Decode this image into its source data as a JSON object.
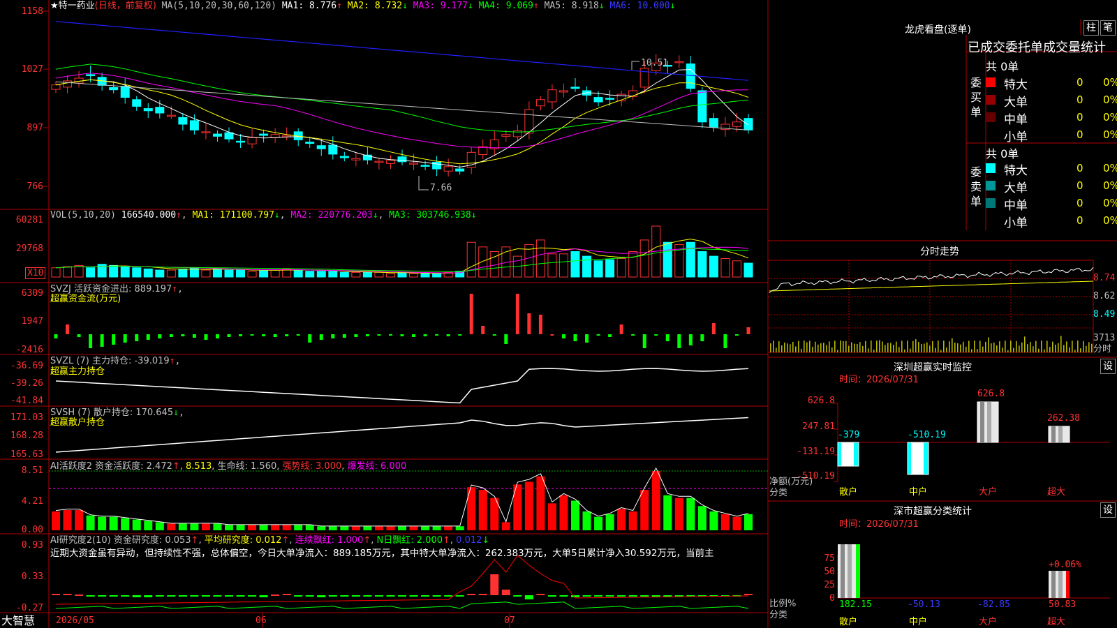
{
  "colors": {
    "up": "#ff3232",
    "down": "#00ffff",
    "grid": "#aa0000",
    "bg": "#000000",
    "ma1": "#ffffff",
    "ma2": "#ffff00",
    "ma3": "#ff00ff",
    "ma4": "#00ff00",
    "ma6": "#2020ff"
  },
  "main": {
    "title": "★特一药业",
    "mode": "(日线，前复权)",
    "ma_label": "MA(5,10,20,30,60,120)",
    "ma1": "MA1: 8.776",
    "ma2": "MA2: 8.732",
    "ma3": "MA3: 9.177",
    "ma4": "MA4: 9.069",
    "ma5": "MA5: 8.918",
    "ma6": "MA6: 10.000",
    "y_ticks": [
      "1158",
      "1027",
      "897",
      "766"
    ],
    "high_label": "10.51",
    "low_label": "7.66"
  },
  "vol": {
    "label": "VOL(5,10,20)",
    "value": "166540.000",
    "ma1": "MA1: 171100.797",
    "ma2": "MA2: 220776.203",
    "ma3": "MA3: 303746.938",
    "y_ticks": [
      "60281",
      "29768"
    ],
    "unit": "X10"
  },
  "svzj": {
    "line1": "SVZJ  活跃资金进出: 889.197",
    "line2": "超赢资金流(万元)",
    "y_ticks": [
      "6309",
      "1947",
      "-2416"
    ]
  },
  "svzl": {
    "line1": "SVZL (7) 主力持仓: -39.019",
    "line2": "超赢主力持仓",
    "y_ticks": [
      "-36.69",
      "-39.26",
      "-41.84"
    ]
  },
  "svsh": {
    "line1": "SVSH (7) 散户持仓: 170.645",
    "line2": "超赢散户持仓",
    "y_ticks": [
      "171.03",
      "168.28",
      "165.63"
    ]
  },
  "ai1": {
    "label": "AI活跃度2 资金活跃度: 2.472",
    "v2": "8.513",
    "life": "生命线: 1.560",
    "strong": "强势线: 3.000",
    "burst": "爆发线: 6.000",
    "y_ticks": [
      "8.51",
      "4.21",
      "0.00"
    ]
  },
  "ai2": {
    "label": "AI研究度2(10) 资金研究度: 0.053",
    "avg": "平均研究度: 0.012",
    "lx": "连续飘红: 1.000",
    "nr": "N日飘红: 2.000",
    "last": "0.012",
    "desc": "近期大资金虽有异动，但持续性不强，总体偏空，今日大单净流入：889.185万元，其中特大单净流入：262.383万元，大单5日累计净入30.592万元，当前主",
    "y_ticks": [
      "0.93",
      "0.33",
      "-0.27"
    ]
  },
  "xaxis": {
    "labels": [
      "2026/05",
      "06",
      "07"
    ],
    "brand": "大智慧"
  },
  "lhb": {
    "title": "龙虎看盘(逐单)",
    "btn1": "柱",
    "btn2": "笔",
    "tabs": "已成交委托单成交量统计",
    "buy_side": "委买单",
    "sell_side": "委卖单",
    "buy_total": "共 0单",
    "sell_total": "共 0单",
    "buy_rows": [
      {
        "name": "特大",
        "count": "0",
        "pct": "0%",
        "color": "#ff0000"
      },
      {
        "name": "大单",
        "count": "0",
        "pct": "0%",
        "color": "#990000"
      },
      {
        "name": "中单",
        "count": "0",
        "pct": "0%",
        "color": "#660000"
      },
      {
        "name": "小单",
        "count": "0",
        "pct": "0%",
        "color": ""
      }
    ],
    "sell_rows": [
      {
        "name": "特大",
        "count": "0",
        "pct": "0%",
        "color": "#00ffff"
      },
      {
        "name": "大单",
        "count": "0",
        "pct": "0%",
        "color": "#009999"
      },
      {
        "name": "中单",
        "count": "0",
        "pct": "0%",
        "color": "#007777"
      },
      {
        "name": "小单",
        "count": "0",
        "pct": "0%",
        "color": ""
      }
    ]
  },
  "intraday": {
    "title": "分时走势",
    "price_ticks": [
      "8.74",
      "8.62",
      "8.49"
    ],
    "vol_tick": "3713",
    "vol_label": "分时"
  },
  "sz_monitor": {
    "title": "深圳超赢实时监控",
    "setting": "设",
    "time": "时间：2026/07/31",
    "y_ticks": [
      "626.8",
      "247.81",
      "-131.19",
      "-510.19"
    ],
    "values": [
      "-379",
      "-510.19",
      "626.8",
      "262.38"
    ],
    "categories": [
      "散户",
      "中户",
      "大户",
      "超大"
    ],
    "ylabel1": "净额(万元)",
    "ylabel2": "分类"
  },
  "sz_class": {
    "title": "深市超赢分类统计",
    "setting": "设",
    "time": "时间：2026/07/31",
    "y_ticks": [
      "75",
      "50",
      "25",
      "0"
    ],
    "pct": "+0.06%",
    "values": [
      "182.15",
      "-50.13",
      "-82.85",
      "50.83"
    ],
    "categories": [
      "散户",
      "中户",
      "大户",
      "超大"
    ],
    "ylabel1": "比例%",
    "ylabel2": "分类"
  }
}
